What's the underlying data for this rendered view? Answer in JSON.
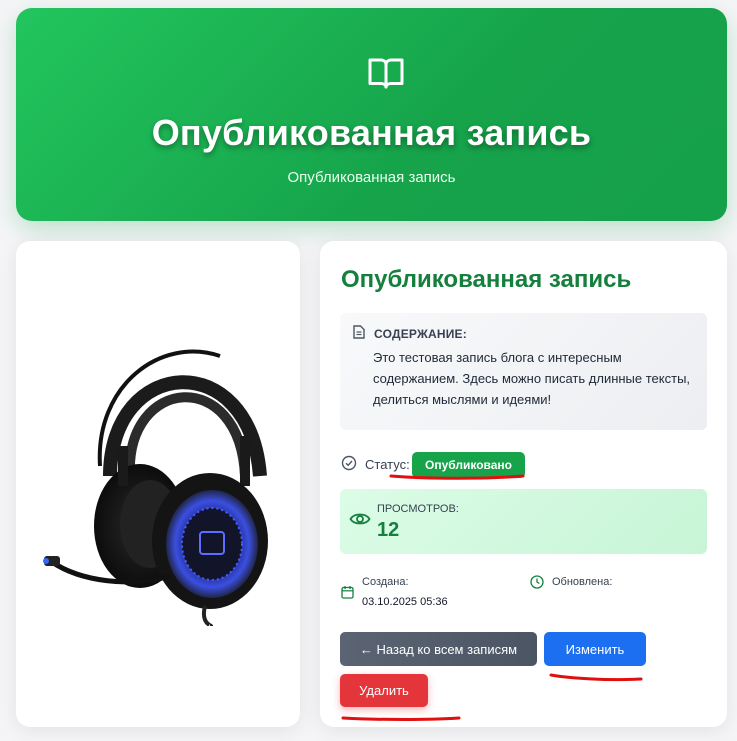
{
  "hero": {
    "icon": "book-open-icon",
    "title": "Опубликованная запись",
    "subtitle": "Опубликованная запись"
  },
  "image": {
    "description_icon": "headset-image"
  },
  "post": {
    "title": "Опубликованная запись",
    "content_label": "СОДЕРЖАНИЕ:",
    "content_text": "Это тестовая запись блога с интересным содержанием. Здесь можно писать длинные тексты, делиться мыслями и идеями!",
    "status_label": "Статус:",
    "status_value": "Опубликовано",
    "views_label": "ПРОСМОТРОВ:",
    "views_count": "12",
    "created_label": "Создана:",
    "created_value": "03.10.2025 05:36",
    "updated_label": "Обновлена:"
  },
  "buttons": {
    "back": "← Назад ко всем записям",
    "edit": "Изменить",
    "delete": "Удалить"
  },
  "colors": {
    "primary_green": "#16a34a",
    "edit_blue": "#1d6ff2",
    "delete_red": "#e4353b",
    "annotation_red": "#e01010"
  }
}
